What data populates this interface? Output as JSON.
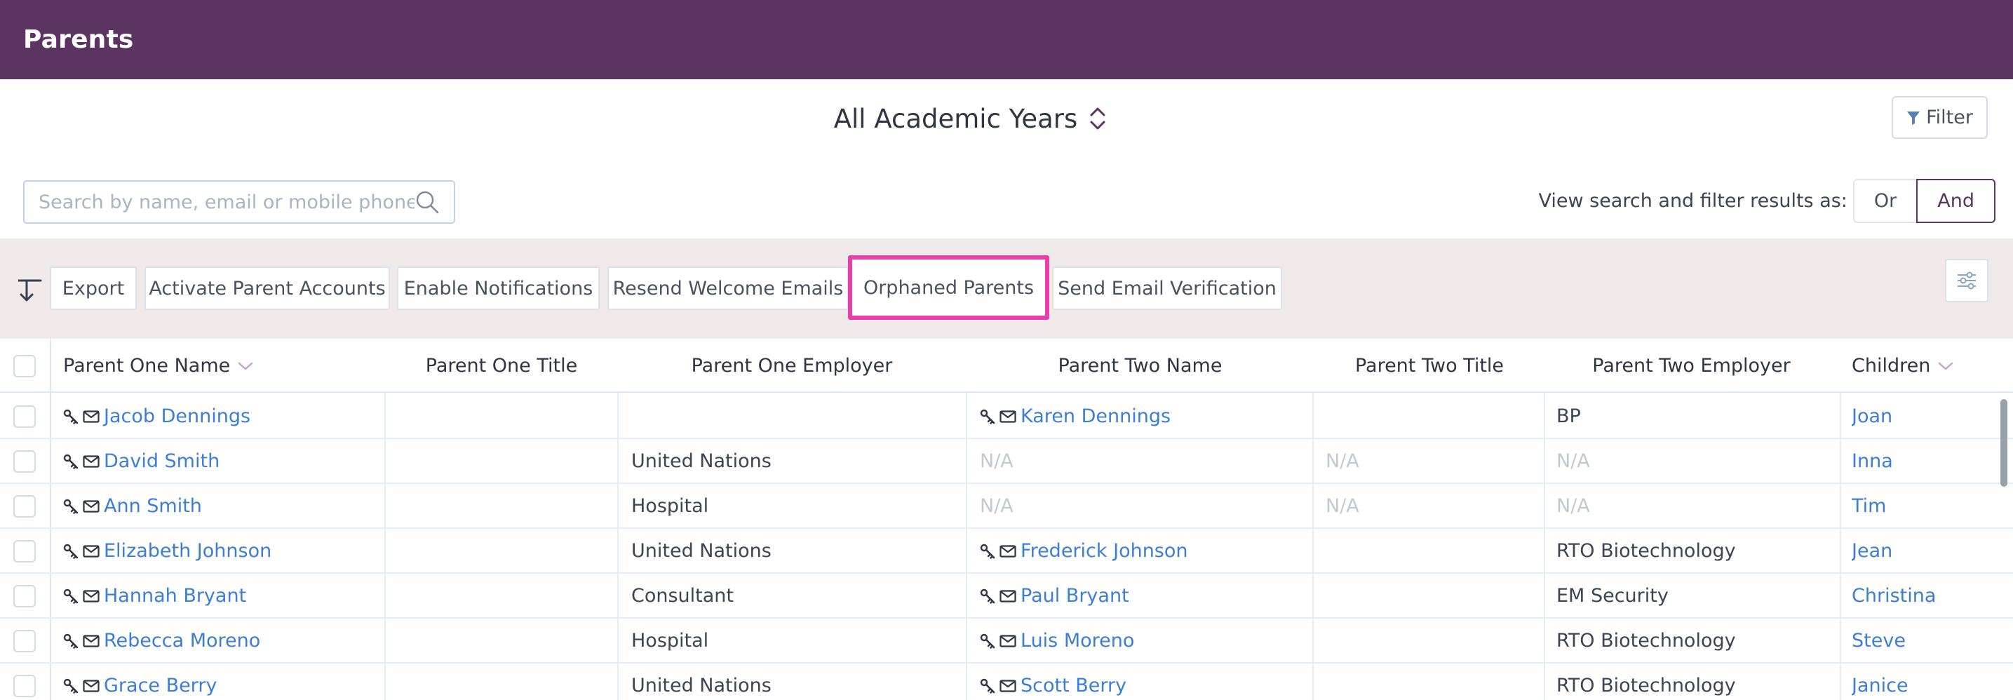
{
  "header": {
    "title": "Parents"
  },
  "academic_year": {
    "label": "All Academic Years"
  },
  "filter": {
    "label": "Filter"
  },
  "search": {
    "placeholder": "Search by name, email or mobile phone..."
  },
  "view_mode": {
    "label": "View search and filter results as:",
    "or_label": "Or",
    "and_label": "And",
    "selected": "And"
  },
  "toolbar": {
    "buttons": [
      {
        "label": "Export"
      },
      {
        "label": "Activate Parent Accounts"
      },
      {
        "label": "Enable Notifications"
      },
      {
        "label": "Resend Welcome Emails"
      },
      {
        "label": "Orphaned Parents"
      },
      {
        "label": "Send Email Verification"
      }
    ]
  },
  "table": {
    "columns": [
      {
        "label": "Parent One Name",
        "sortable": true
      },
      {
        "label": "Parent One Title",
        "sortable": false
      },
      {
        "label": "Parent One Employer",
        "sortable": false
      },
      {
        "label": "Parent Two Name",
        "sortable": false
      },
      {
        "label": "Parent Two Title",
        "sortable": false
      },
      {
        "label": "Parent Two Employer",
        "sortable": false
      },
      {
        "label": "Children",
        "sortable": true
      }
    ],
    "rows": [
      {
        "p1_name": "Jacob Dennings",
        "p1_title": "",
        "p1_employer": "",
        "p2_name": "Karen Dennings",
        "p2_title": "",
        "p2_employer": "BP",
        "children": "Joan"
      },
      {
        "p1_name": "David Smith",
        "p1_title": "",
        "p1_employer": "United Nations",
        "p2_name": "N/A",
        "p2_title": "N/A",
        "p2_employer": "N/A",
        "children": "Inna"
      },
      {
        "p1_name": "Ann Smith",
        "p1_title": "",
        "p1_employer": "Hospital",
        "p2_name": "N/A",
        "p2_title": "N/A",
        "p2_employer": "N/A",
        "children": "Tim"
      },
      {
        "p1_name": "Elizabeth Johnson",
        "p1_title": "",
        "p1_employer": "United Nations",
        "p2_name": "Frederick Johnson",
        "p2_title": "",
        "p2_employer": "RTO Biotechnology",
        "children": "Jean"
      },
      {
        "p1_name": "Hannah Bryant",
        "p1_title": "",
        "p1_employer": "Consultant",
        "p2_name": "Paul Bryant",
        "p2_title": "",
        "p2_employer": "EM Security",
        "children": "Christina"
      },
      {
        "p1_name": "Rebecca Moreno",
        "p1_title": "",
        "p1_employer": "Hospital",
        "p2_name": "Luis Moreno",
        "p2_title": "",
        "p2_employer": "RTO Biotechnology",
        "children": "Steve"
      },
      {
        "p1_name": "Grace Berry",
        "p1_title": "",
        "p1_employer": "United Nations",
        "p2_name": "Scott Berry",
        "p2_title": "",
        "p2_employer": "RTO Biotechnology",
        "children": "Janice"
      }
    ]
  },
  "colors": {
    "brand": "#5c3461",
    "link": "#3b7ed8",
    "highlight": "#e83ea8",
    "toolbar_bg": "#efe9e9"
  },
  "icons": {
    "row_key": "key-icon",
    "row_mail": "mail-icon",
    "sort": "chevron-down-icon",
    "filter": "funnel-icon",
    "search": "search-icon",
    "settings": "sliders-icon",
    "updown": "updown-chevron-icon",
    "bulk": "arrow-down-left-icon"
  }
}
